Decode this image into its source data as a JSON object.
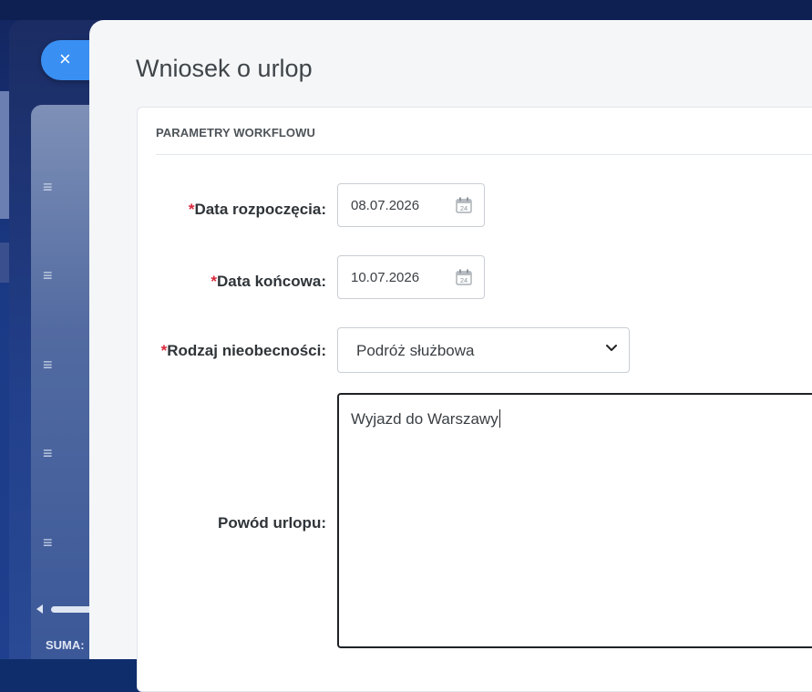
{
  "modal": {
    "title": "Wniosek o urlop",
    "close_symbol": "×"
  },
  "section": {
    "header": "PARAMETRY WORKFLOWU"
  },
  "form": {
    "required_marker": "*",
    "start_date": {
      "label": "Data rozpoczęcia:",
      "value": "08.07.2026",
      "calendar_day": "24"
    },
    "end_date": {
      "label": "Data końcowa:",
      "value": "10.07.2026",
      "calendar_day": "24"
    },
    "absence_type": {
      "label": "Rodzaj nieobecności:",
      "value": "Podróż służbowa"
    },
    "reason": {
      "label": "Powód urlopu:",
      "value": "Wyjazd do Warszawy"
    }
  },
  "background": {
    "sum_label": "SUMA:"
  },
  "icons": {
    "close": "close-icon",
    "calendar": "calendar-icon",
    "dropdown": "chevron-down-icon",
    "drag": "drag-handle-icon"
  },
  "colors": {
    "accent": "#3a8ff2",
    "required": "#d9263b",
    "backdrop": "#1a3a86"
  }
}
